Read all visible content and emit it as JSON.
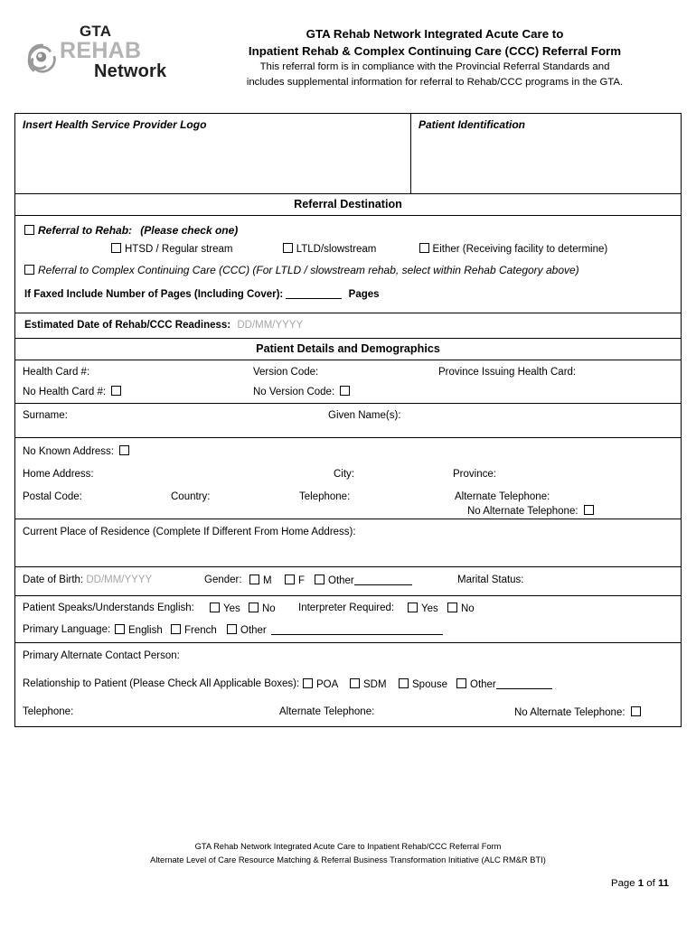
{
  "logo": {
    "line1": "GTA",
    "line2": "REHAB",
    "line3": "Network",
    "mark": "spiral-swirl-icon"
  },
  "header": {
    "title_line1": "GTA Rehab Network Integrated Acute Care to",
    "title_line2": "Inpatient Rehab & Complex Continuing Care (CCC) Referral Form",
    "sub_line1": "This referral form is in compliance with the Provincial Referral Standards and",
    "sub_line2": "includes supplemental information for referral to Rehab/CCC programs in the GTA."
  },
  "identification": {
    "provider_logo_label": "Insert Health Service Provider Logo",
    "patient_identification_label": "Patient Identification"
  },
  "referral_destination": {
    "band_title": "Referral Destination",
    "rehab_label": "Referral to Rehab:",
    "rehab_hint": "(Please check one)",
    "streams": [
      {
        "label": "HTSD / Regular stream"
      },
      {
        "label": "LTLD/slowstream"
      },
      {
        "label": "Either (Receiving facility to determine)"
      }
    ],
    "ccc_label": "Referral to Complex Continuing Care (CCC) (For LTLD / slowstream rehab, select within Rehab Category above)",
    "fax_label": "If Faxed Include Number of Pages (Including Cover):",
    "fax_suffix": "Pages"
  },
  "readiness": {
    "label": "Estimated Date of Rehab/CCC Readiness:",
    "placeholder": "DD/MM/YYYY"
  },
  "patient_details": {
    "band_title": "Patient Details and Demographics",
    "health_card_label": "Health Card #:",
    "version_code_label": "Version Code:",
    "province_issuing_label": "Province Issuing Health Card:",
    "no_health_card_label": "No Health Card #:",
    "no_version_code_label": "No Version Code:",
    "surname_label": "Surname:",
    "given_names_label": "Given Name(s):",
    "no_known_address_label": "No Known Address:",
    "home_address_label": "Home Address:",
    "city_label": "City:",
    "province_label": "Province:",
    "postal_code_label": "Postal Code:",
    "country_label": "Country:",
    "telephone_label": "Telephone:",
    "alternate_telephone_label": "Alternate Telephone:",
    "no_alternate_telephone_label": "No Alternate Telephone:",
    "current_residence_label": "Current Place of Residence  (Complete If Different From Home Address):",
    "date_of_birth_label": "Date of Birth:",
    "date_of_birth_placeholder": "DD/MM/YYYY",
    "gender_label": "Gender:",
    "gender_m": "M",
    "gender_f": "F",
    "gender_other": "Other",
    "marital_status_label": "Marital Status:",
    "speaks_english_label": "Patient Speaks/Understands English:",
    "yes": "Yes",
    "no": "No",
    "interpreter_label": "Interpreter Required:",
    "primary_language_label": "Primary Language:",
    "lang_english": "English",
    "lang_french": "French",
    "lang_other": "Other"
  },
  "contact": {
    "primary_contact_label": "Primary Alternate Contact Person:",
    "relationship_label": "Relationship to Patient (Please Check All Applicable Boxes):",
    "rel_poa": "POA",
    "rel_sdm": "SDM",
    "rel_spouse": "Spouse",
    "rel_other": "Other",
    "telephone_label": "Telephone:",
    "alternate_telephone_label": "Alternate Telephone:",
    "no_alternate_telephone_label": "No Alternate Telephone:"
  },
  "footer": {
    "line1": "GTA Rehab Network Integrated Acute Care to Inpatient Rehab/CCC Referral Form",
    "line2": "Alternate Level of Care Resource Matching & Referral Business Transformation Initiative (ALC RM&R BTI)",
    "page_prefix": "Page",
    "page_number": "1",
    "page_mid": "of",
    "page_total": "11"
  }
}
